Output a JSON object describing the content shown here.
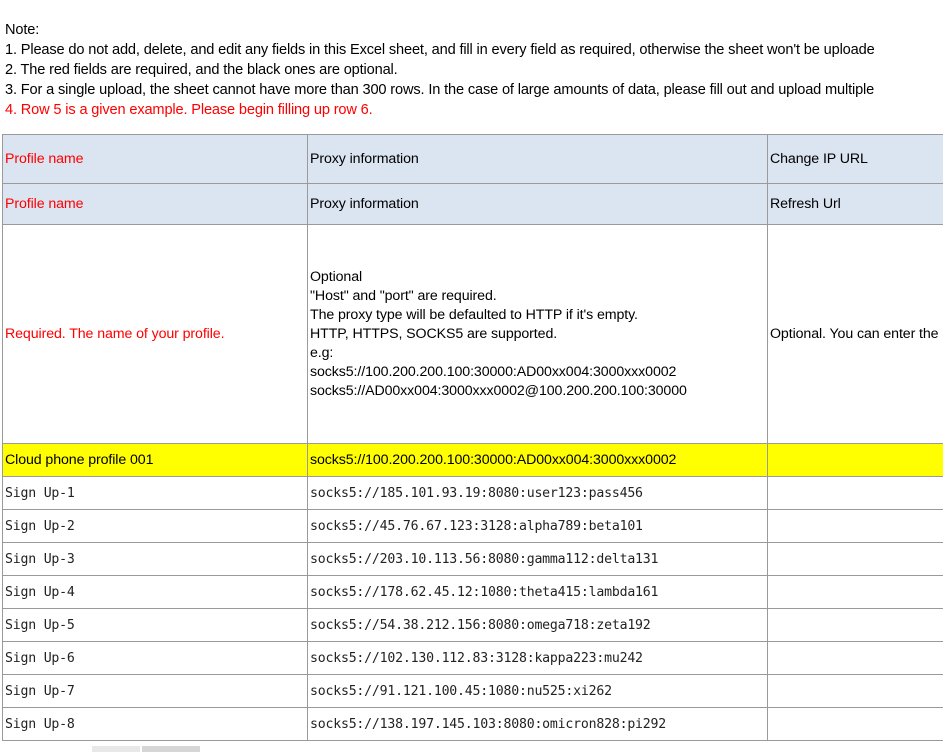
{
  "notes": {
    "heading": "Note:",
    "line1": "1. Please do not add, delete, and edit any fields in this Excel sheet, and fill in every field as required, otherwise the sheet won't be uploade",
    "line2": "2. The red fields are required, and the black ones are optional.",
    "line3": "3. For a single upload, the sheet cannot have more than 300 rows. In the case of large amounts of data, please fill out and upload multiple",
    "line4": "4. Row 5 is a given example. Please begin filling up row 6."
  },
  "header_row1": {
    "col1": "Profile name",
    "col2": "Proxy information",
    "col3": "Change IP URL"
  },
  "header_row2": {
    "col1": "Profile name",
    "col2": "Proxy information",
    "col3": "Refresh Url"
  },
  "description_row": {
    "col1": "Required. The name of your profile.",
    "col2_lines": [
      "Optional",
      "\"Host\" and \"port\" are required.",
      "The proxy type will be defaulted to HTTP if it's empty.",
      "HTTP, HTTPS, SOCKS5 are supported.",
      "e.g:",
      "socks5://100.200.200.100:30000:AD00xx004:3000xxx0002",
      "socks5://AD00xx004:3000xxx0002@100.200.200.100:30000"
    ],
    "col3": "Optional. You can enter the"
  },
  "example_row": {
    "col1": "Cloud phone profile 001",
    "col2": "socks5://100.200.200.100:30000:AD00xx004:3000xxx0002",
    "col3": ""
  },
  "data_rows": [
    {
      "name": "Sign Up-1",
      "proxy": "socks5://185.101.93.19:8080:user123:pass456",
      "url": ""
    },
    {
      "name": "Sign Up-2",
      "proxy": "socks5://45.76.67.123:3128:alpha789:beta101",
      "url": ""
    },
    {
      "name": "Sign Up-3",
      "proxy": "socks5://203.10.113.56:8080:gamma112:delta131",
      "url": ""
    },
    {
      "name": "Sign Up-4",
      "proxy": "socks5://178.62.45.12:1080:theta415:lambda161",
      "url": ""
    },
    {
      "name": "Sign Up-5",
      "proxy": "socks5://54.38.212.156:8080:omega718:zeta192",
      "url": ""
    },
    {
      "name": "Sign Up-6",
      "proxy": "socks5://102.130.112.83:3128:kappa223:mu242",
      "url": ""
    },
    {
      "name": "Sign Up-7",
      "proxy": "socks5://91.121.100.45:1080:nu525:xi262",
      "url": ""
    },
    {
      "name": "Sign Up-8",
      "proxy": "socks5://138.197.145.103:8080:omicron828:pi292",
      "url": ""
    }
  ],
  "colors": {
    "header_fill": "#dbe4f1",
    "example_fill": "#ffff00",
    "required_text": "#ff0000",
    "grid_line": "#9a9a9a"
  }
}
